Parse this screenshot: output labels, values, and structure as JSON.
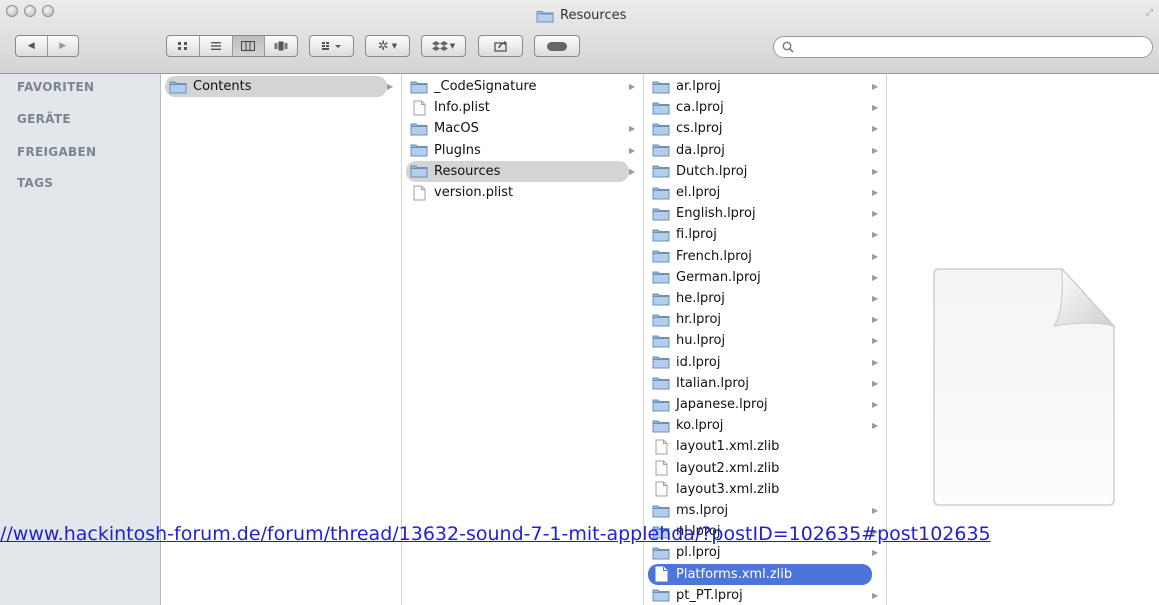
{
  "window": {
    "title": "Resources"
  },
  "toolbar": {
    "back_glyph": "◀",
    "forward_glyph": "▶",
    "view_icons": [
      "icon-view-icon",
      "list-view-icon",
      "column-view-icon",
      "coverflow-view-icon"
    ],
    "arrange_icon": "arrange-icon",
    "action_icon": "gear-icon",
    "dropbox_icon": "dropbox-icon",
    "share_icon": "share-icon",
    "tags_icon": "toggle-icon",
    "search": {
      "placeholder": "",
      "value": ""
    }
  },
  "sidebar": {
    "sections": [
      "FAVORITEN",
      "GERÄTE",
      "FREIGABEN",
      "TAGS"
    ]
  },
  "columns": [
    {
      "items": [
        {
          "name": "Contents",
          "kind": "folder",
          "selected": true,
          "has_children": true
        }
      ]
    },
    {
      "items": [
        {
          "name": "_CodeSignature",
          "kind": "folder",
          "has_children": true
        },
        {
          "name": "Info.plist",
          "kind": "file"
        },
        {
          "name": "MacOS",
          "kind": "folder",
          "has_children": true
        },
        {
          "name": "PlugIns",
          "kind": "folder",
          "has_children": true
        },
        {
          "name": "Resources",
          "kind": "folder",
          "selected": true,
          "has_children": true
        },
        {
          "name": "version.plist",
          "kind": "file"
        }
      ]
    },
    {
      "items": [
        {
          "name": "ar.lproj",
          "kind": "folder",
          "has_children": true
        },
        {
          "name": "ca.lproj",
          "kind": "folder",
          "has_children": true
        },
        {
          "name": "cs.lproj",
          "kind": "folder",
          "has_children": true
        },
        {
          "name": "da.lproj",
          "kind": "folder",
          "has_children": true
        },
        {
          "name": "Dutch.lproj",
          "kind": "folder",
          "has_children": true
        },
        {
          "name": "el.lproj",
          "kind": "folder",
          "has_children": true
        },
        {
          "name": "English.lproj",
          "kind": "folder",
          "has_children": true
        },
        {
          "name": "fi.lproj",
          "kind": "folder",
          "has_children": true
        },
        {
          "name": "French.lproj",
          "kind": "folder",
          "has_children": true
        },
        {
          "name": "German.lproj",
          "kind": "folder",
          "has_children": true
        },
        {
          "name": "he.lproj",
          "kind": "folder",
          "has_children": true
        },
        {
          "name": "hr.lproj",
          "kind": "folder",
          "has_children": true
        },
        {
          "name": "hu.lproj",
          "kind": "folder",
          "has_children": true
        },
        {
          "name": "id.lproj",
          "kind": "folder",
          "has_children": true
        },
        {
          "name": "Italian.lproj",
          "kind": "folder",
          "has_children": true
        },
        {
          "name": "Japanese.lproj",
          "kind": "folder",
          "has_children": true
        },
        {
          "name": "ko.lproj",
          "kind": "folder",
          "has_children": true
        },
        {
          "name": "layout1.xml.zlib",
          "kind": "file"
        },
        {
          "name": "layout2.xml.zlib",
          "kind": "file"
        },
        {
          "name": "layout3.xml.zlib",
          "kind": "file"
        },
        {
          "name": "ms.lproj",
          "kind": "folder",
          "has_children": true
        },
        {
          "name": "nl.lproj",
          "kind": "folder",
          "has_children": true
        },
        {
          "name": "pl.lproj",
          "kind": "folder",
          "has_children": true
        },
        {
          "name": "Platforms.xml.zlib",
          "kind": "file",
          "selected_blue": true
        },
        {
          "name": "pt_PT.lproj",
          "kind": "folder",
          "has_children": true
        }
      ]
    }
  ],
  "overlay_link": "//www.hackintosh-forum.de/forum/thread/13632-sound-7-1-mit-applehda/?postID=102635#post102635",
  "colors": {
    "selection_gray": "#d4d4d4",
    "selection_blue": "#4d74d8",
    "sidebar_bg": "#e3e7ec",
    "folder_blue": "#8fb4dd",
    "link_blue": "#1f1fd8"
  }
}
